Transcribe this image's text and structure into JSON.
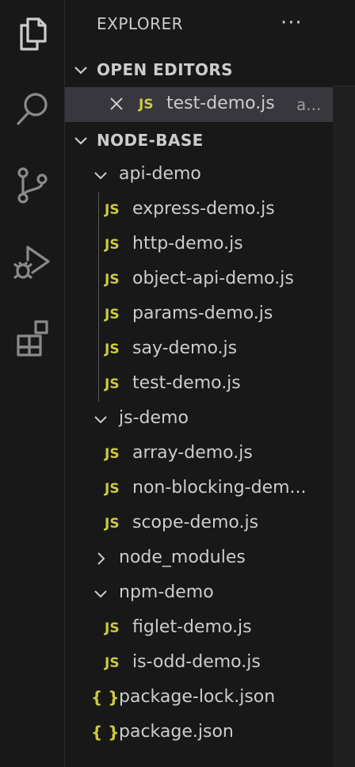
{
  "colors": {
    "background": "#181818",
    "text": "#cccccc",
    "js_badge": "#cbcb41",
    "selected_row": "#37373d"
  },
  "activity_bar": {
    "icons": [
      "explorer-icon",
      "search-icon",
      "source-control-icon",
      "run-debug-icon",
      "extensions-icon"
    ]
  },
  "explorer": {
    "title": "EXPLORER",
    "more_actions": "···",
    "open_editors": {
      "header": "OPEN EDITORS",
      "items": [
        {
          "badge": "JS",
          "name": "test-demo.js",
          "path": "a..."
        }
      ]
    },
    "workspace": {
      "header": "NODE-BASE",
      "tree": {
        "api_demo": "api-demo",
        "api_demo_files": [
          "express-demo.js",
          "http-demo.js",
          "object-api-demo.js",
          "params-demo.js",
          "say-demo.js",
          "test-demo.js"
        ],
        "js_demo": "js-demo",
        "js_demo_files": [
          "array-demo.js",
          "non-blocking-dem...",
          "scope-demo.js"
        ],
        "node_modules": "node_modules",
        "npm_demo": "npm-demo",
        "npm_demo_files": [
          "figlet-demo.js",
          "is-odd-demo.js"
        ],
        "root_files": [
          "package-lock.json",
          "package.json"
        ]
      },
      "js_badge": "JS",
      "json_badge": "{ }"
    }
  }
}
